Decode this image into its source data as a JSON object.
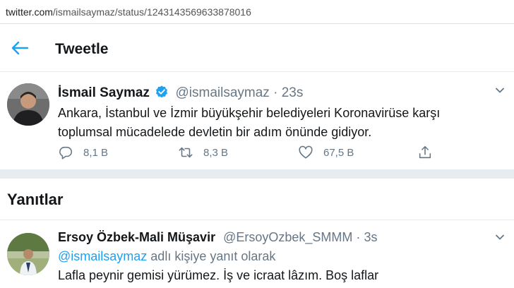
{
  "browser": {
    "url_host": "twitter.com",
    "url_path": "/ismailsaymaz/status/1243143569633878016"
  },
  "header": {
    "title": "Tweetle",
    "back_icon": "arrow-left-icon"
  },
  "tweet": {
    "name": "İsmail Saymaz",
    "handle": "@ismailsaymaz",
    "separator": "·",
    "time": "23s",
    "text": "Ankara, İstanbul ve İzmir büyükşehir belediyeleri Koronavirüse karşı toplumsal mücadelede devletin bir adım önünde gidiyor.",
    "stats": {
      "replies": "8,1 B",
      "retweets": "8,3 B",
      "likes": "67,5 B"
    },
    "accent_color": "#1da1f2"
  },
  "replies": {
    "title": "Yanıtlar",
    "items": [
      {
        "name": "Ersoy Özbek-Mali Müşavir",
        "handle": "@ErsoyOzbek_SMMM",
        "separator": "·",
        "time": "3s",
        "reply_mention": "@ismailsaymaz",
        "reply_suffix": " adlı kişiye yanıt olarak",
        "text": "Lafla peynir gemisi yürümez. İş ve icraat lâzım. Boş laflar"
      }
    ]
  }
}
